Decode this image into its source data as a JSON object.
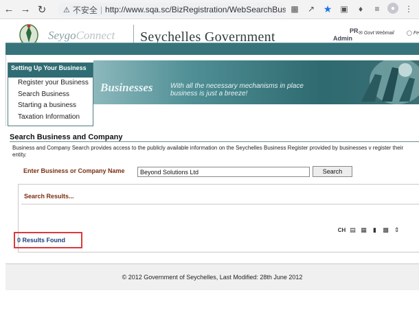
{
  "browser": {
    "insecure_label": "不安全",
    "url": "http://www.sqa.sc/BizRegistration/WebSearchBusi..."
  },
  "header": {
    "logo_text_1": "Seygo",
    "logo_text_2": "Connect",
    "title": "Seychelles Government",
    "pr": "PR",
    "admin": "Admin",
    "webmail": "Govt Webmail",
    "feed": "Fe"
  },
  "menu": {
    "heading": "Setting Up Your Business",
    "items": [
      "Register your Business",
      "Search Business",
      "Starting a business",
      "Taxation Information"
    ]
  },
  "banner": {
    "title": "Businesses",
    "subtitle_1": "With all the necessary mechanisms in place",
    "subtitle_2": "business is just a breeze!"
  },
  "content": {
    "title": "Search Business and Company",
    "description": "Business and Company Search provides access to the publicly available information on the Seychelles Business Register provided by businesses v register their entity.",
    "label": "Enter Business or Company Name",
    "input_value": "Beyond Solutions Ltd",
    "search_button": "Search",
    "results_heading": "Search Results...",
    "results_count": "0 Results Found",
    "toolbar_text": "CH"
  },
  "footer": {
    "text": "© 2012 Government of Seychelles, Last Modified: 28th June 2012"
  }
}
